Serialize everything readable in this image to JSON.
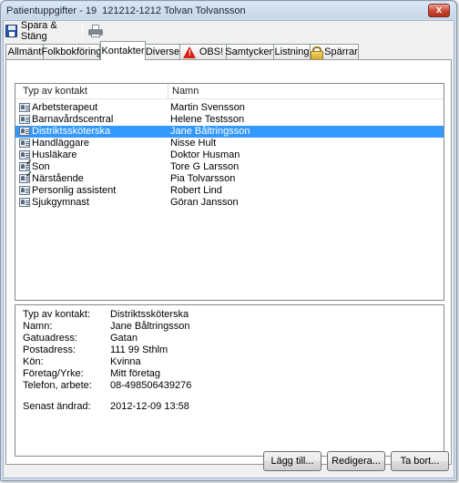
{
  "window": {
    "title": "Patientuppgifter - 19  121212-1212 Tolvan Tolvansson",
    "close_label": "x"
  },
  "toolbar": {
    "save_label": "Spara & Stäng",
    "save_icon": "floppy-disk-icon",
    "print_icon": "printer-icon"
  },
  "tabs": [
    {
      "label": "Allmänt"
    },
    {
      "label": "Folkbokföring"
    },
    {
      "label": "Kontakter",
      "active": true
    },
    {
      "label": "Diverse"
    },
    {
      "label": "OBS!",
      "icon": "warning-icon"
    },
    {
      "label": "Samtycken"
    },
    {
      "label": "Listning"
    },
    {
      "label": "Spärrar",
      "icon": "lock-icon"
    }
  ],
  "contacts": {
    "columns": {
      "type": "Typ av kontakt",
      "name": "Namn"
    },
    "rows": [
      {
        "type": "Arbetsterapeut",
        "name": "Martin Svensson"
      },
      {
        "type": "Barnavårdscentral",
        "name": "Helene Testsson"
      },
      {
        "type": "Distriktssköterska",
        "name": "Jane Båltringsson",
        "selected": true
      },
      {
        "type": "Handläggare",
        "name": "Nisse Hult"
      },
      {
        "type": "Husläkare",
        "name": "Doktor Husman"
      },
      {
        "type": "Son",
        "name": "Tore G Larsson",
        "checked": true
      },
      {
        "type": "Närstående",
        "name": "Pia Tolvarsson",
        "checked": true
      },
      {
        "type": "Personlig assistent",
        "name": "Robert Lind"
      },
      {
        "type": "Sjukgymnast",
        "name": "Göran Jansson"
      }
    ]
  },
  "details": {
    "fields": [
      {
        "label": "Typ av kontakt:",
        "value": "Distriktssköterska"
      },
      {
        "label": "Namn:",
        "value": "Jane Båltringsson"
      },
      {
        "label": "Gatuadress:",
        "value": "Gatan"
      },
      {
        "label": "Postadress:",
        "value": "111 99 Sthlm"
      },
      {
        "label": "Kön:",
        "value": "Kvinna"
      },
      {
        "label": "Företag/Yrke:",
        "value": "Mitt företag"
      },
      {
        "label": "Telefon, arbete:",
        "value": "08-498506439276"
      }
    ],
    "modified_label": "Senast ändrad:",
    "modified_value": "2012-12-09 13:58"
  },
  "buttons": {
    "add": "Lägg till...",
    "edit": "Redigera...",
    "delete": "Ta bort..."
  },
  "colors": {
    "selection": "#3399ff",
    "warning": "#d91f10"
  }
}
